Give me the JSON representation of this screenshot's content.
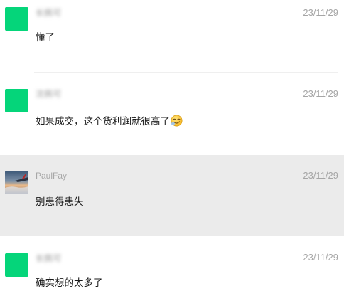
{
  "messages": [
    {
      "name": "长佩可",
      "time": "23/11/29",
      "text": "懂了",
      "emoji": ""
    },
    {
      "name": "沈佩可",
      "time": "23/11/29",
      "text": "如果成交，这个货利润就很高了",
      "emoji": "smirk-emoji"
    },
    {
      "name": "PaulFay",
      "time": "23/11/29",
      "text": "别患得患失",
      "emoji": ""
    },
    {
      "name": "长佩可",
      "time": "23/11/29",
      "text": "确实想的太多了",
      "emoji": ""
    }
  ],
  "colors": {
    "avatar_green": "#05d57a",
    "highlight_row": "#ebebeb",
    "name_gray": "#a7a7a7",
    "time_gray": "#a5a5a5"
  }
}
